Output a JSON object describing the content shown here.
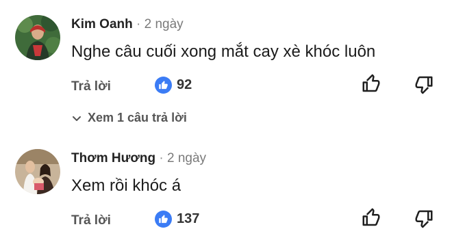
{
  "comments": [
    {
      "author": "Kim Oanh",
      "separator": "·",
      "time": "2 ngày",
      "text": "Nghe câu cuối xong mắt cay xè khóc luôn",
      "reply_label": "Trả lời",
      "like_count": "92",
      "view_replies_label": "Xem 1 câu trả lời"
    },
    {
      "author": "Thơm Hương",
      "separator": "·",
      "time": "2 ngày",
      "text": "Xem rồi khóc á",
      "reply_label": "Trả lời",
      "like_count": "137"
    }
  ],
  "colors": {
    "like_badge": "#3b7cf5",
    "secondary_text": "#555555"
  },
  "icons": [
    "avatar",
    "like-icon",
    "thumbs-up-icon",
    "thumbs-down-icon",
    "chevron-down-icon"
  ]
}
